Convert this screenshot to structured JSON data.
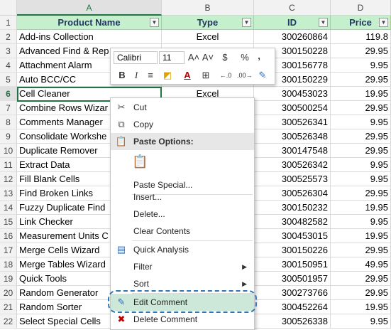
{
  "columns": [
    "A",
    "B",
    "C",
    "D"
  ],
  "headers": {
    "name": "Product Name",
    "type": "Type",
    "id": "ID",
    "price": "Price"
  },
  "rows": [
    {
      "n": "2",
      "name": "Add-ins Collection",
      "type": "Excel",
      "id": "300260864",
      "price": "119.8"
    },
    {
      "n": "3",
      "name": "Advanced Find & Rep",
      "type": "",
      "id": "300150228",
      "price": "29.95"
    },
    {
      "n": "4",
      "name": "Attachment Alarm",
      "type": "",
      "id": "300156778",
      "price": "9.95"
    },
    {
      "n": "5",
      "name": "Auto BCC/CC",
      "type": "",
      "id": "300150229",
      "price": "29.95"
    },
    {
      "n": "6",
      "name": "Cell Cleaner",
      "type": "Excel",
      "id": "300453023",
      "price": "19.95"
    },
    {
      "n": "7",
      "name": "Combine Rows Wizar",
      "type": "",
      "id": "300500254",
      "price": "29.95"
    },
    {
      "n": "8",
      "name": "Comments Manager",
      "type": "",
      "id": "300526341",
      "price": "9.95"
    },
    {
      "n": "9",
      "name": "Consolidate Workshe",
      "type": "",
      "id": "300526348",
      "price": "29.95"
    },
    {
      "n": "10",
      "name": "Duplicate Remover",
      "type": "",
      "id": "300147548",
      "price": "29.95"
    },
    {
      "n": "11",
      "name": "Extract Data",
      "type": "",
      "id": "300526342",
      "price": "9.95"
    },
    {
      "n": "12",
      "name": "Fill Blank Cells",
      "type": "",
      "id": "300525573",
      "price": "9.95"
    },
    {
      "n": "13",
      "name": "Find Broken Links",
      "type": "",
      "id": "300526304",
      "price": "29.95"
    },
    {
      "n": "14",
      "name": "Fuzzy Duplicate Find",
      "type": "",
      "id": "300150232",
      "price": "19.95"
    },
    {
      "n": "15",
      "name": "Link Checker",
      "type": "",
      "id": "300482582",
      "price": "9.95"
    },
    {
      "n": "16",
      "name": "Measurement Units C",
      "type": "",
      "id": "300453015",
      "price": "19.95"
    },
    {
      "n": "17",
      "name": "Merge Cells Wizard",
      "type": "",
      "id": "300150226",
      "price": "29.95"
    },
    {
      "n": "18",
      "name": "Merge Tables Wizard",
      "type": "",
      "id": "300150951",
      "price": "49.95"
    },
    {
      "n": "19",
      "name": "Quick Tools",
      "type": "",
      "id": "300501957",
      "price": "29.95"
    },
    {
      "n": "20",
      "name": "Random Generator",
      "type": "",
      "id": "300273766",
      "price": "29.95"
    },
    {
      "n": "21",
      "name": "Random Sorter",
      "type": "",
      "id": "300452264",
      "price": "19.95"
    },
    {
      "n": "22",
      "name": "Select Special Cells",
      "type": "",
      "id": "300526338",
      "price": "9.95"
    }
  ],
  "mini_toolbar": {
    "font": "Calibri",
    "size": "11",
    "grow": "A˄",
    "shrink": "A˅",
    "currency": "$",
    "percent": "%",
    "comma": ",",
    "bold": "B",
    "italic": "I",
    "align": "≡",
    "fill": "◩",
    "font_color": "A",
    "borders": "⊞",
    "inc_dec": "←.0",
    "dec_dec": ".00→",
    "painter": "✎"
  },
  "menu": {
    "cut": "Cut",
    "copy": "Copy",
    "paste_options": "Paste Options:",
    "paste_special": "Paste Special...",
    "insert": "Insert...",
    "delete": "Delete...",
    "clear_contents": "Clear Contents",
    "quick_analysis": "Quick Analysis",
    "filter": "Filter",
    "sort": "Sort",
    "edit_comment": "Edit Comment",
    "delete_comment": "Delete Comment",
    "submenu_arrow": "▶"
  },
  "header_row_num": "1",
  "filter_glyph": "▼",
  "colors": {
    "header_fill": "#c6efce",
    "accent": "#217346",
    "highlight": "#2e75b6"
  }
}
